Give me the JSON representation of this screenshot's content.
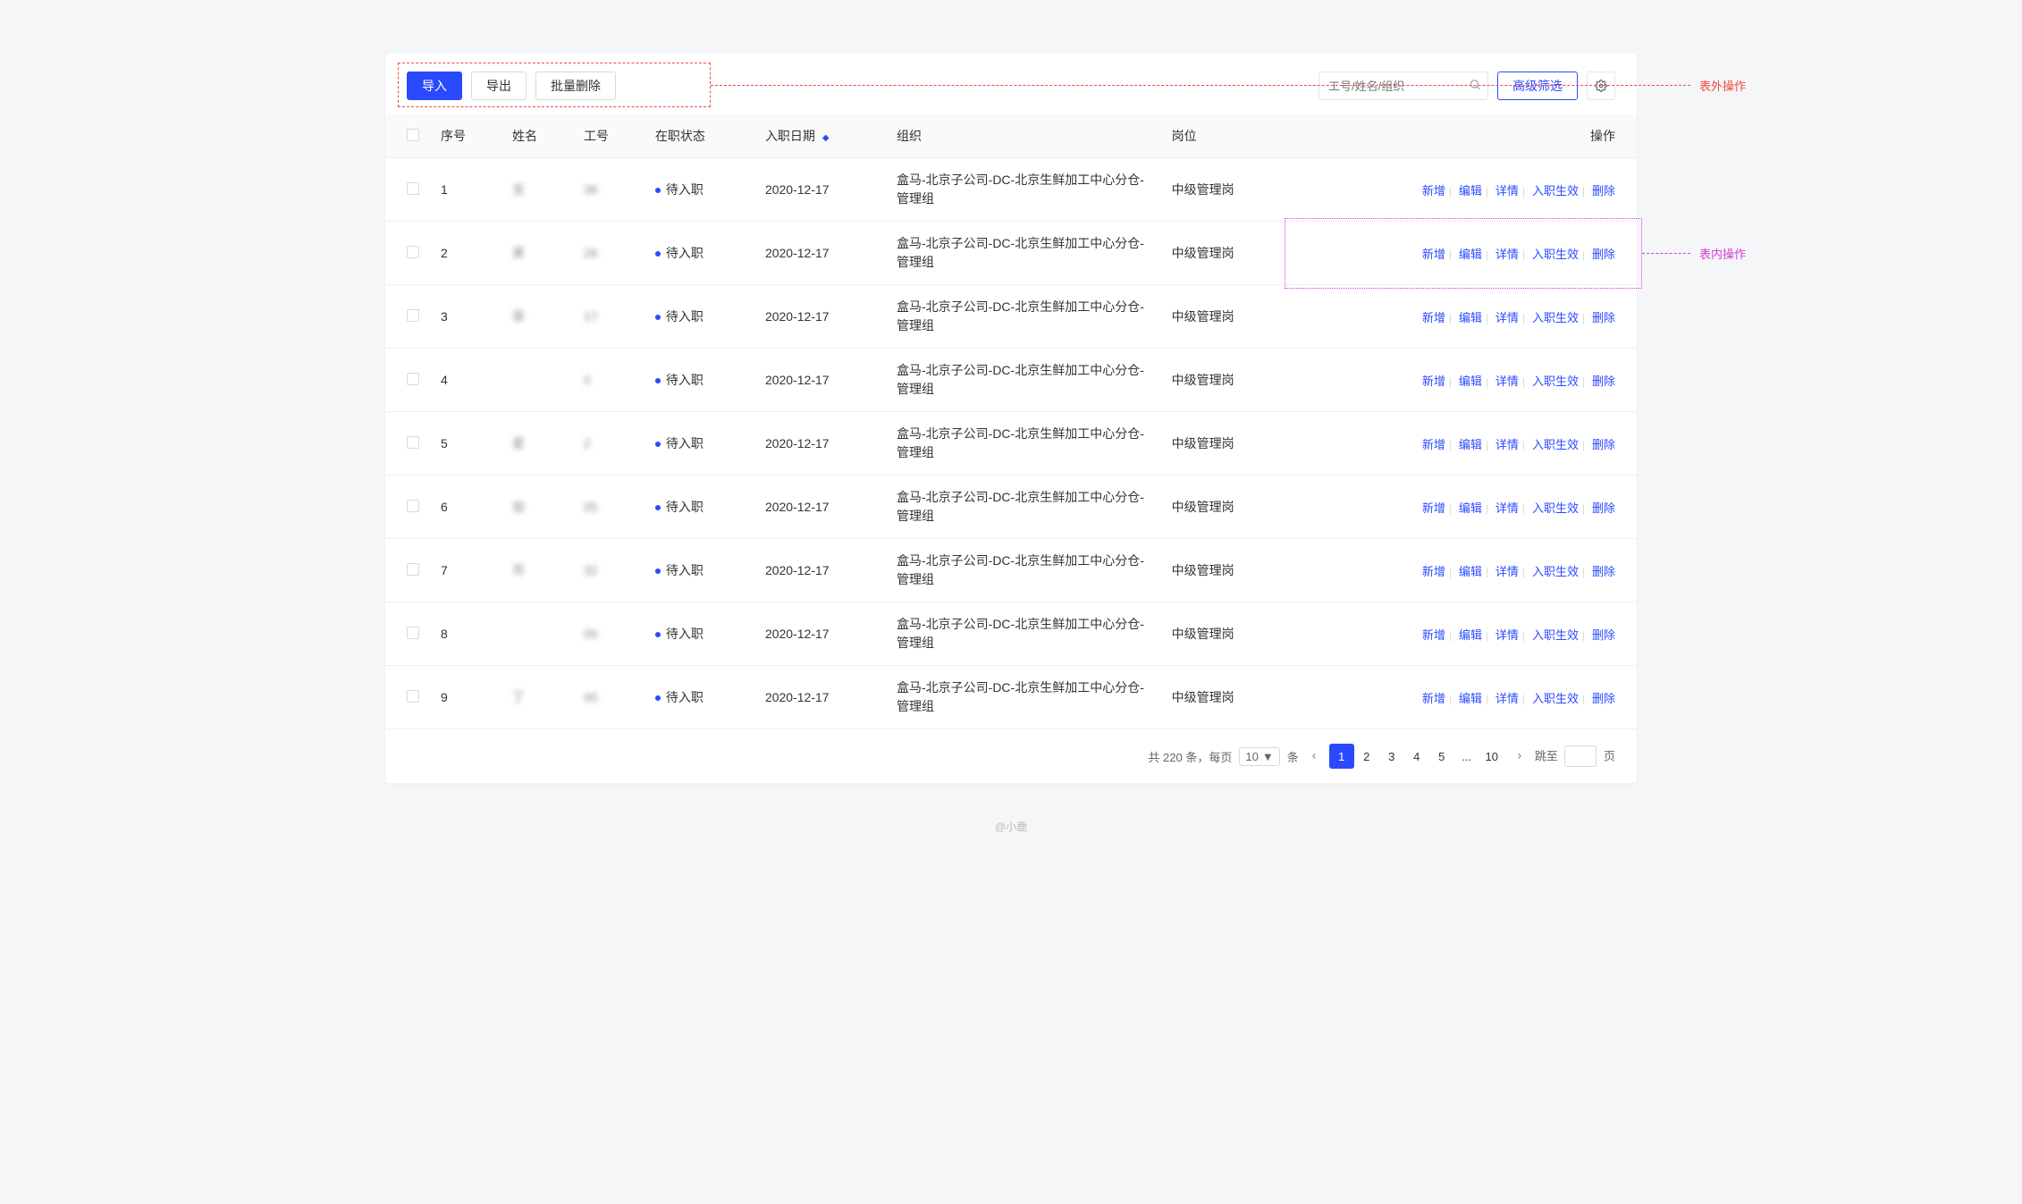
{
  "toolbar": {
    "import_label": "导入",
    "export_label": "导出",
    "batch_delete_label": "批量删除",
    "search_placeholder": "工号/姓名/组织",
    "advanced_filter_label": "高级筛选"
  },
  "annotations": {
    "toolbar_label": "表外操作",
    "row_action_label": "表内操作"
  },
  "table": {
    "headers": {
      "seq": "序号",
      "name": "姓名",
      "emp_no": "工号",
      "status": "在职状态",
      "hire_date": "入职日期",
      "org": "组织",
      "position": "岗位",
      "action": "操作"
    },
    "row_actions": {
      "add": "新增",
      "edit": "编辑",
      "detail": "详情",
      "activate": "入职生效",
      "delete": "删除"
    },
    "rows": [
      {
        "seq": "1",
        "name": "支",
        "emp_no": "38",
        "status": "待入职",
        "hire_date": "2020-12-17",
        "org": "盒马-北京子公司-DC-北京生鲜加工中心分仓-管理组",
        "position": "中级管理岗"
      },
      {
        "seq": "2",
        "name": "昊",
        "emp_no": "26",
        "status": "待入职",
        "hire_date": "2020-12-17",
        "org": "盒马-北京子公司-DC-北京生鲜加工中心分仓-管理组",
        "position": "中级管理岗"
      },
      {
        "seq": "3",
        "name": "菲",
        "emp_no": "17",
        "status": "待入职",
        "hire_date": "2020-12-17",
        "org": "盒马-北京子公司-DC-北京生鲜加工中心分仓-管理组",
        "position": "中级管理岗"
      },
      {
        "seq": "4",
        "name": "",
        "emp_no": "0",
        "status": "待入职",
        "hire_date": "2020-12-17",
        "org": "盒马-北京子公司-DC-北京生鲜加工中心分仓-管理组",
        "position": "中级管理岗"
      },
      {
        "seq": "5",
        "name": "星",
        "emp_no": "2",
        "status": "待入职",
        "hire_date": "2020-12-17",
        "org": "盒马-北京子公司-DC-北京生鲜加工中心分仓-管理组",
        "position": "中级管理岗"
      },
      {
        "seq": "6",
        "name": "加",
        "emp_no": "05",
        "status": "待入职",
        "hire_date": "2020-12-17",
        "org": "盒马-北京子公司-DC-北京生鲜加工中心分仓-管理组",
        "position": "中级管理岗"
      },
      {
        "seq": "7",
        "name": "帀",
        "emp_no": "32",
        "status": "待入职",
        "hire_date": "2020-12-17",
        "org": "盒马-北京子公司-DC-北京生鲜加工中心分仓-管理组",
        "position": "中级管理岗"
      },
      {
        "seq": "8",
        "name": "",
        "emp_no": "00",
        "status": "待入职",
        "hire_date": "2020-12-17",
        "org": "盒马-北京子公司-DC-北京生鲜加工中心分仓-管理组",
        "position": "中级管理岗"
      },
      {
        "seq": "9",
        "name": "丁",
        "emp_no": "00",
        "status": "待入职",
        "hire_date": "2020-12-17",
        "org": "盒马-北京子公司-DC-北京生鲜加工中心分仓-管理组",
        "position": "中级管理岗"
      }
    ]
  },
  "pagination": {
    "total_prefix": "共",
    "total_count": "220",
    "total_suffix": "条，每页",
    "page_size": "10",
    "page_size_suffix": "条",
    "pages": [
      "1",
      "2",
      "3",
      "4",
      "5",
      "...",
      "10"
    ],
    "current": "1",
    "jump_prefix": "跳至",
    "jump_suffix": "页"
  },
  "footer": {
    "credit": "@小鹿"
  }
}
